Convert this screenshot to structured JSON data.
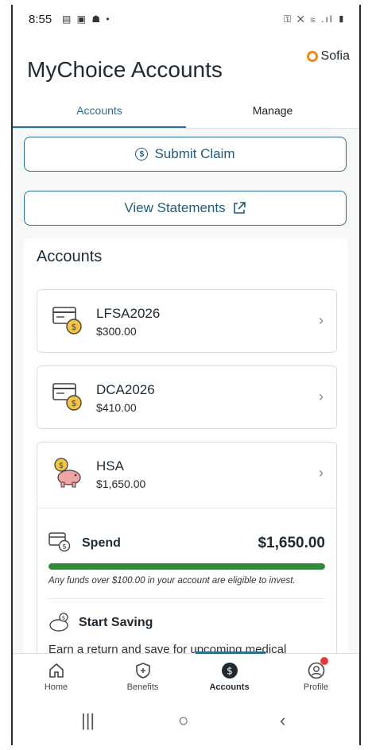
{
  "status_bar": {
    "time": "8:55",
    "left_icons": "▤ ▣ ☗ •",
    "right_icons": "⚿ ✕ ≋ .ıl ▮"
  },
  "header": {
    "title": "MyChoice Accounts",
    "assistant_label": "Sofia"
  },
  "tabs": [
    {
      "label": "Accounts",
      "active": true
    },
    {
      "label": "Manage",
      "active": false
    }
  ],
  "actions": {
    "submit_claim": "Submit Claim",
    "view_statements": "View Statements"
  },
  "accounts": {
    "heading": "Accounts",
    "items": [
      {
        "name": "LFSA2026",
        "balance": "$300.00",
        "icon": "card-coin-icon"
      },
      {
        "name": "DCA2026",
        "balance": "$410.00",
        "icon": "card-coin-icon"
      },
      {
        "name": "HSA",
        "balance": "$1,650.00",
        "icon": "piggy-bank-icon"
      }
    ],
    "hsa_details": {
      "spend_label": "Spend",
      "spend_value": "$1,650.00",
      "spend_progress_percent": 100,
      "note": "Any funds over $100.00 in your account are eligible to invest.",
      "saving_label": "Start Saving",
      "saving_desc": "Earn a return and save for upcoming medical"
    }
  },
  "bottom_nav": [
    {
      "label": "Home",
      "icon": "home-icon",
      "active": false
    },
    {
      "label": "Benefits",
      "icon": "shield-icon",
      "active": false
    },
    {
      "label": "Accounts",
      "icon": "dollar-icon",
      "active": true
    },
    {
      "label": "Profile",
      "icon": "profile-icon",
      "active": false
    }
  ],
  "system_nav": {
    "recents": "|||",
    "home": "○",
    "back": "‹"
  },
  "colors": {
    "accent": "#2b6f8f",
    "progress": "#2f8a3c",
    "sofia": "#f28a1a",
    "badge": "#e53935"
  }
}
